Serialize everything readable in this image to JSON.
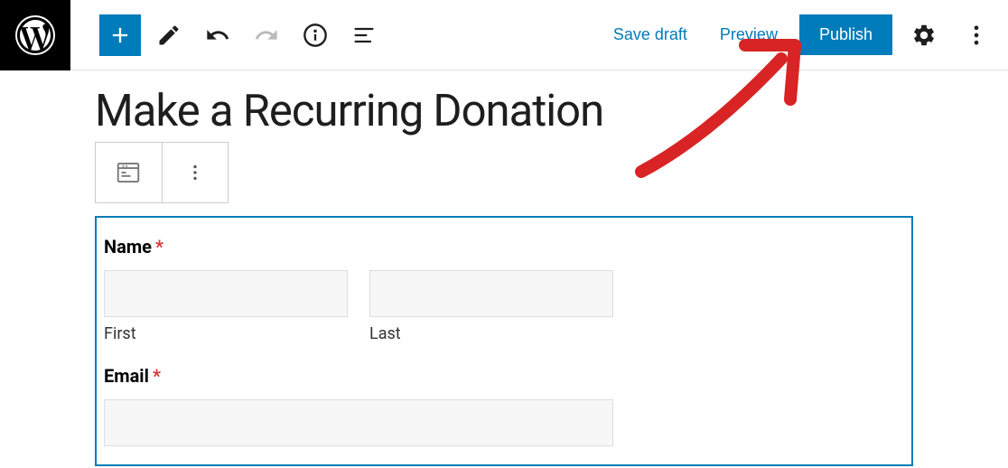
{
  "header": {
    "save_draft_label": "Save draft",
    "preview_label": "Preview",
    "publish_label": "Publish"
  },
  "page": {
    "title": "Make a Recurring Donation"
  },
  "form": {
    "name_label": "Name",
    "required_mark": "*",
    "first_sublabel": "First",
    "last_sublabel": "Last",
    "email_label": "Email"
  }
}
